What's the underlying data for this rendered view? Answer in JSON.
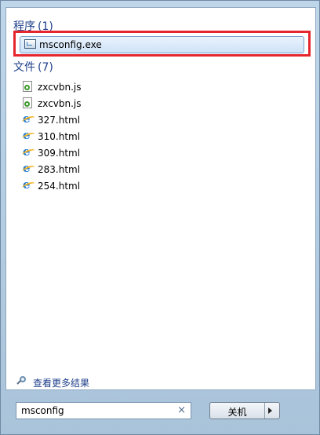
{
  "programs": {
    "heading": "程序",
    "count": "(1)",
    "items": [
      {
        "label": "msconfig.exe",
        "icon": "program-window-icon"
      }
    ]
  },
  "files": {
    "heading": "文件",
    "count": "(7)",
    "items": [
      {
        "label": "zxcvbn.js",
        "icon": "js-file-icon"
      },
      {
        "label": "zxcvbn.js",
        "icon": "js-file-icon"
      },
      {
        "label": "327.html",
        "icon": "ie-icon"
      },
      {
        "label": "310.html",
        "icon": "ie-icon"
      },
      {
        "label": "309.html",
        "icon": "ie-icon"
      },
      {
        "label": "283.html",
        "icon": "ie-icon"
      },
      {
        "label": "254.html",
        "icon": "ie-icon"
      }
    ]
  },
  "more_results": {
    "label": "查看更多结果",
    "icon": "magnifier-icon"
  },
  "search": {
    "value": "msconfig",
    "clear_icon": "×"
  },
  "shutdown": {
    "label": "关机",
    "arrow_icon": "arrow-right-icon"
  },
  "colors": {
    "highlight_border": "#e5262e",
    "heading": "#1e3f8a"
  }
}
